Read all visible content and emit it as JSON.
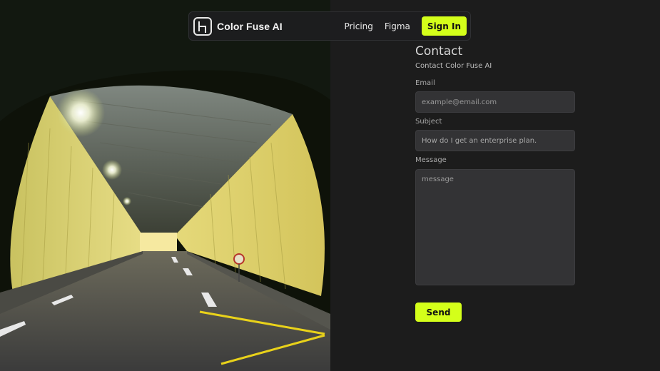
{
  "nav": {
    "brand": "Color Fuse AI",
    "links": [
      "Pricing",
      "Figma"
    ],
    "signin_label": "Sign In"
  },
  "contact": {
    "title": "Contact",
    "subtitle": "Contact Color Fuse AI",
    "email": {
      "label": "Email",
      "placeholder": "example@email.com",
      "value": ""
    },
    "subject": {
      "label": "Subject",
      "placeholder": "",
      "value": "How do I get an enterprise plan."
    },
    "message": {
      "label": "Message",
      "placeholder": "message",
      "value": ""
    },
    "send_label": "Send"
  },
  "colors": {
    "accent": "#d4ff1a",
    "background": "#1c1c1c",
    "field": "#333335"
  },
  "icons": {
    "logo": "app-logo-icon"
  }
}
